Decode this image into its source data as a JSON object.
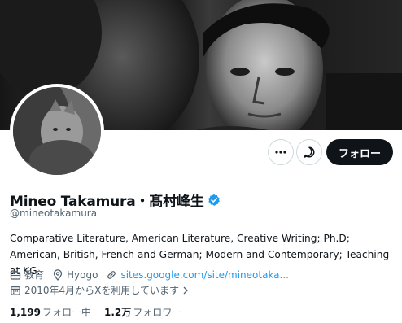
{
  "profile": {
    "name": "Mineo Takamura・髙村峰生",
    "handle": "@mineotakamura",
    "bio": "Comparative Literature, American Literature, Creative Writing; Ph.D;  American, British, French and German; Modern and Contemporary; Teaching at KG.",
    "category": "教育",
    "location": "Hyogo",
    "website": "sites.google.com/site/mineotaka...",
    "joined": "2010年4月からXを利用しています",
    "following_count": "1,199",
    "following_label": "フォロー中",
    "followers_count": "1.2万",
    "followers_label": "フォロワー"
  },
  "actions": {
    "more_icon": "more-horizontal-icon",
    "message_icon": "message-icon",
    "follow_label": "フォロー"
  },
  "colors": {
    "accent": "#1d9bf0",
    "text": "#0f1419",
    "secondary_text": "#536471",
    "follow_button_bg": "#0f1419",
    "border": "#cfd9de"
  }
}
